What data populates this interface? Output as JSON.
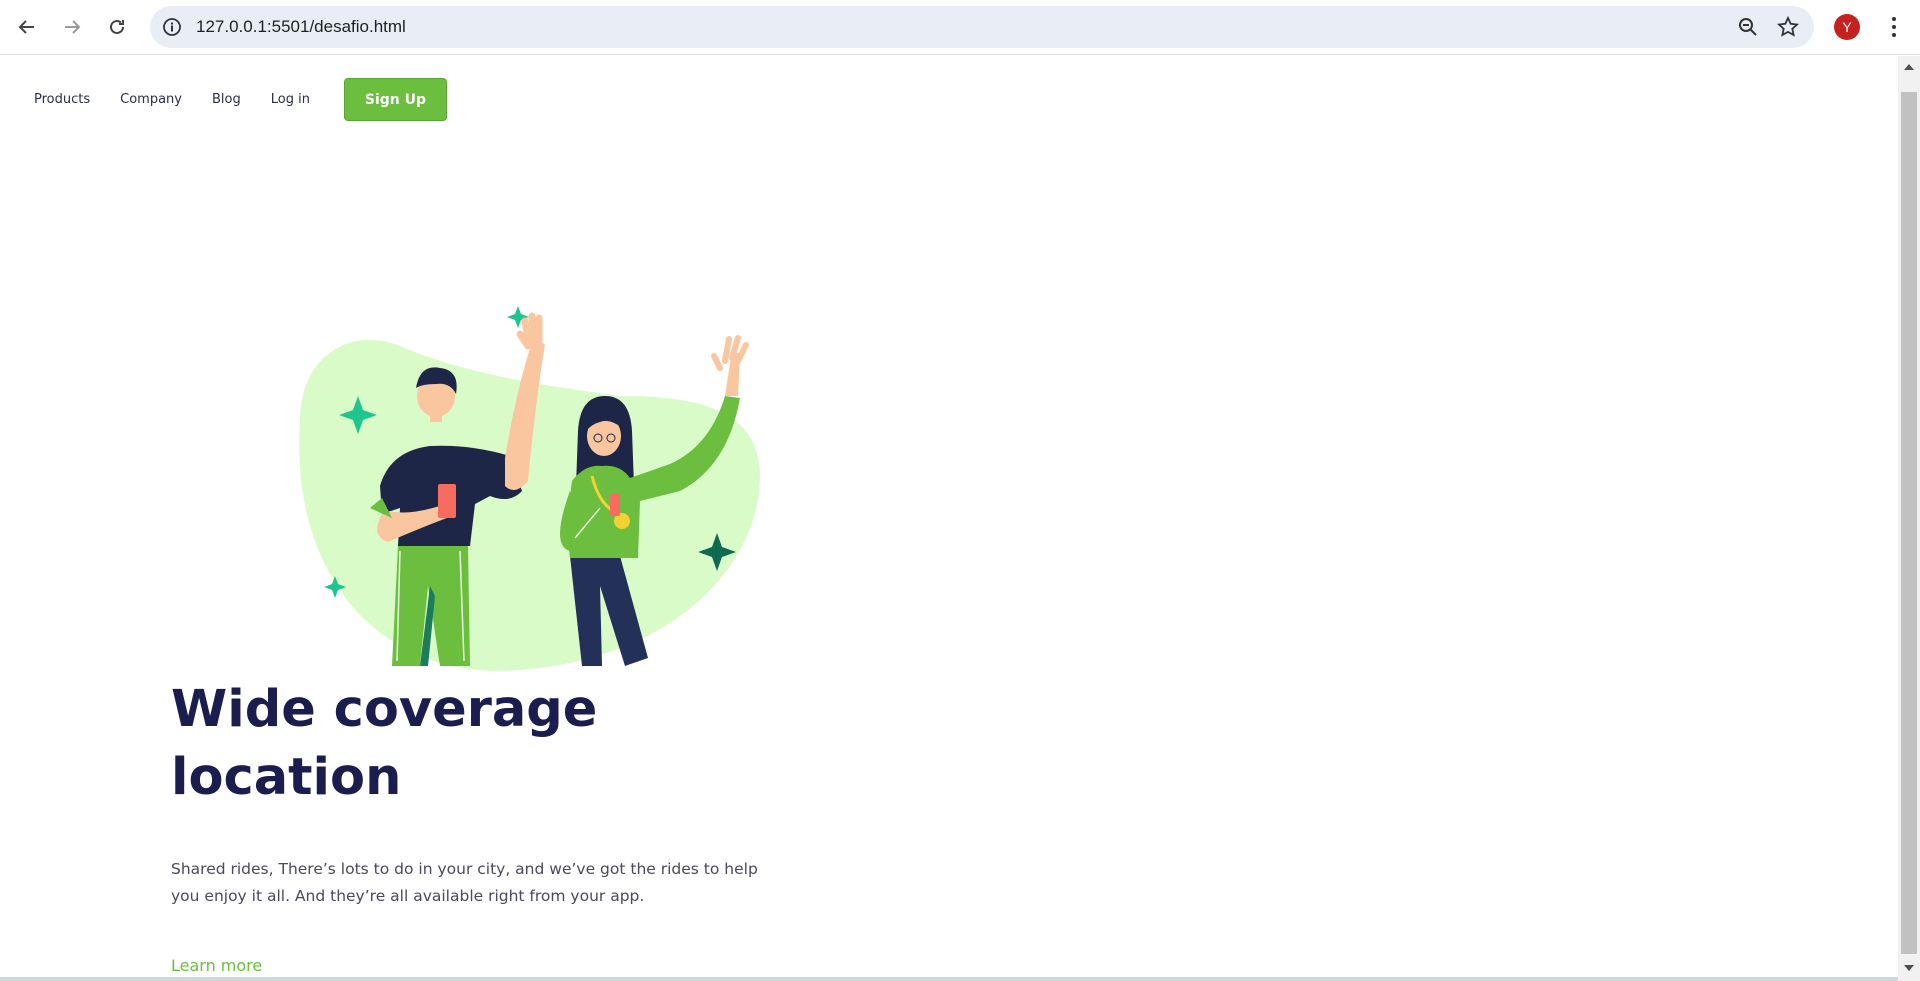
{
  "browser": {
    "url": "127.0.0.1:5501/desafio.html",
    "profile_initial": "Y",
    "profile_color": "#c5221f",
    "icons": [
      "back-icon",
      "forward-icon",
      "reload-icon",
      "info-icon",
      "zoom-out-icon",
      "star-icon",
      "kebab-menu-icon"
    ]
  },
  "nav": {
    "items": [
      {
        "label": "Products"
      },
      {
        "label": "Company"
      },
      {
        "label": "Blog"
      },
      {
        "label": "Log in"
      }
    ],
    "signup_label": "Sign Up"
  },
  "hero": {
    "headline": "Wide coverage location",
    "description": "Shared rides, There’s lots to do in your city, and we’ve got the rides to help you enjoy it all. And they’re all available right from your app.",
    "cta": "Learn more"
  },
  "colors": {
    "accent": "#6cbf3e",
    "headline": "#1a1d4e",
    "blob": "#d9fbc8"
  }
}
